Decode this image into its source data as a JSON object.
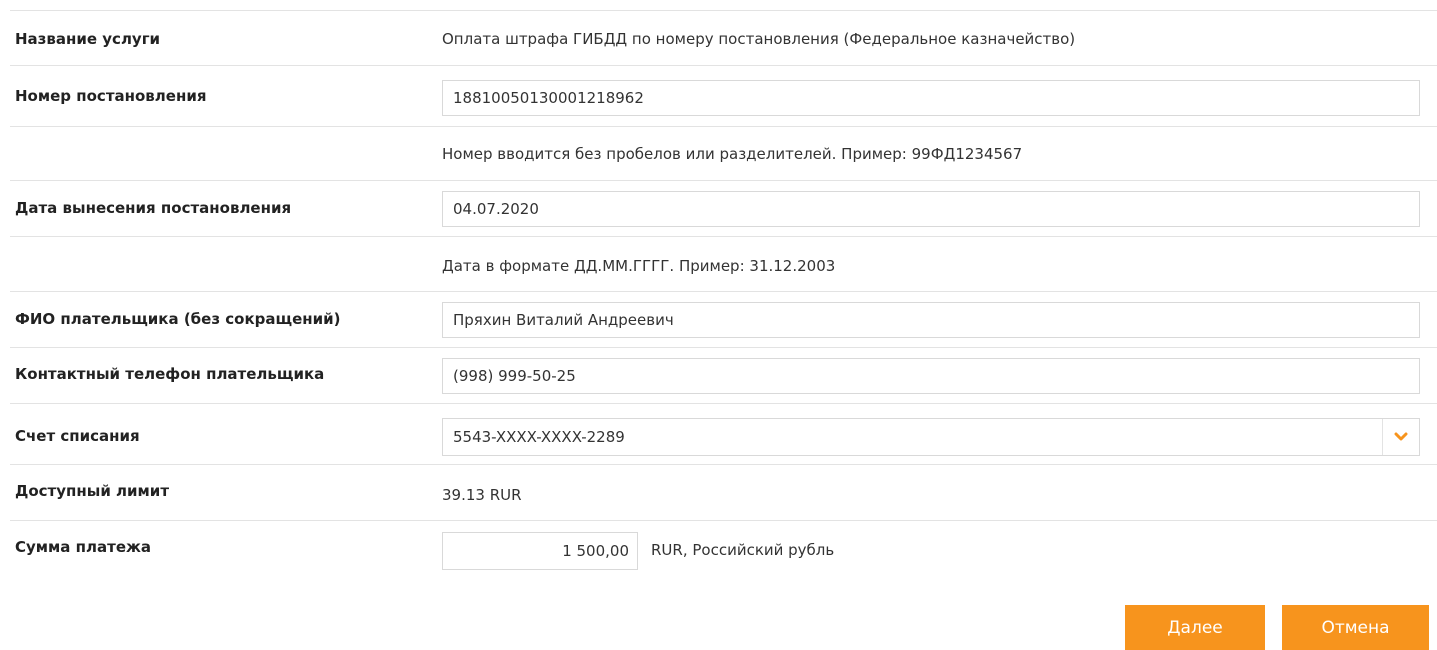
{
  "form": {
    "service": {
      "label": "Название услуги",
      "value": "Оплата штрафа ГИБДД по номеру постановления (Федеральное казначейство)"
    },
    "resolution_number": {
      "label": "Номер постановления",
      "value": "18810050130001218962",
      "hint": "Номер вводится без пробелов или разделителей. Пример: 99ФД1234567"
    },
    "resolution_date": {
      "label": "Дата вынесения постановления",
      "value": "04.07.2020",
      "hint": "Дата в формате ДД.ММ.ГГГГ. Пример: 31.12.2003"
    },
    "payer_name": {
      "label": "ФИО плательщика (без сокращений)",
      "value": "Пряхин Виталий Андреевич"
    },
    "payer_phone": {
      "label": "Контактный телефон плательщика",
      "value": "(998) 999-50-25"
    },
    "debit_account": {
      "label": "Счет списания",
      "selected": "5543-XXXX-XXXX-2289",
      "icon": "chevron-down-icon"
    },
    "available_limit": {
      "label": "Доступный лимит",
      "value": "39.13 RUR"
    },
    "payment_amount": {
      "label": "Сумма платежа",
      "value": "1 500,00",
      "currency": "RUR, Российский рубль"
    }
  },
  "actions": {
    "next_label": "Далее",
    "cancel_label": "Отмена"
  },
  "colors": {
    "accent": "#f7941d",
    "border": "#e3e3e3"
  }
}
